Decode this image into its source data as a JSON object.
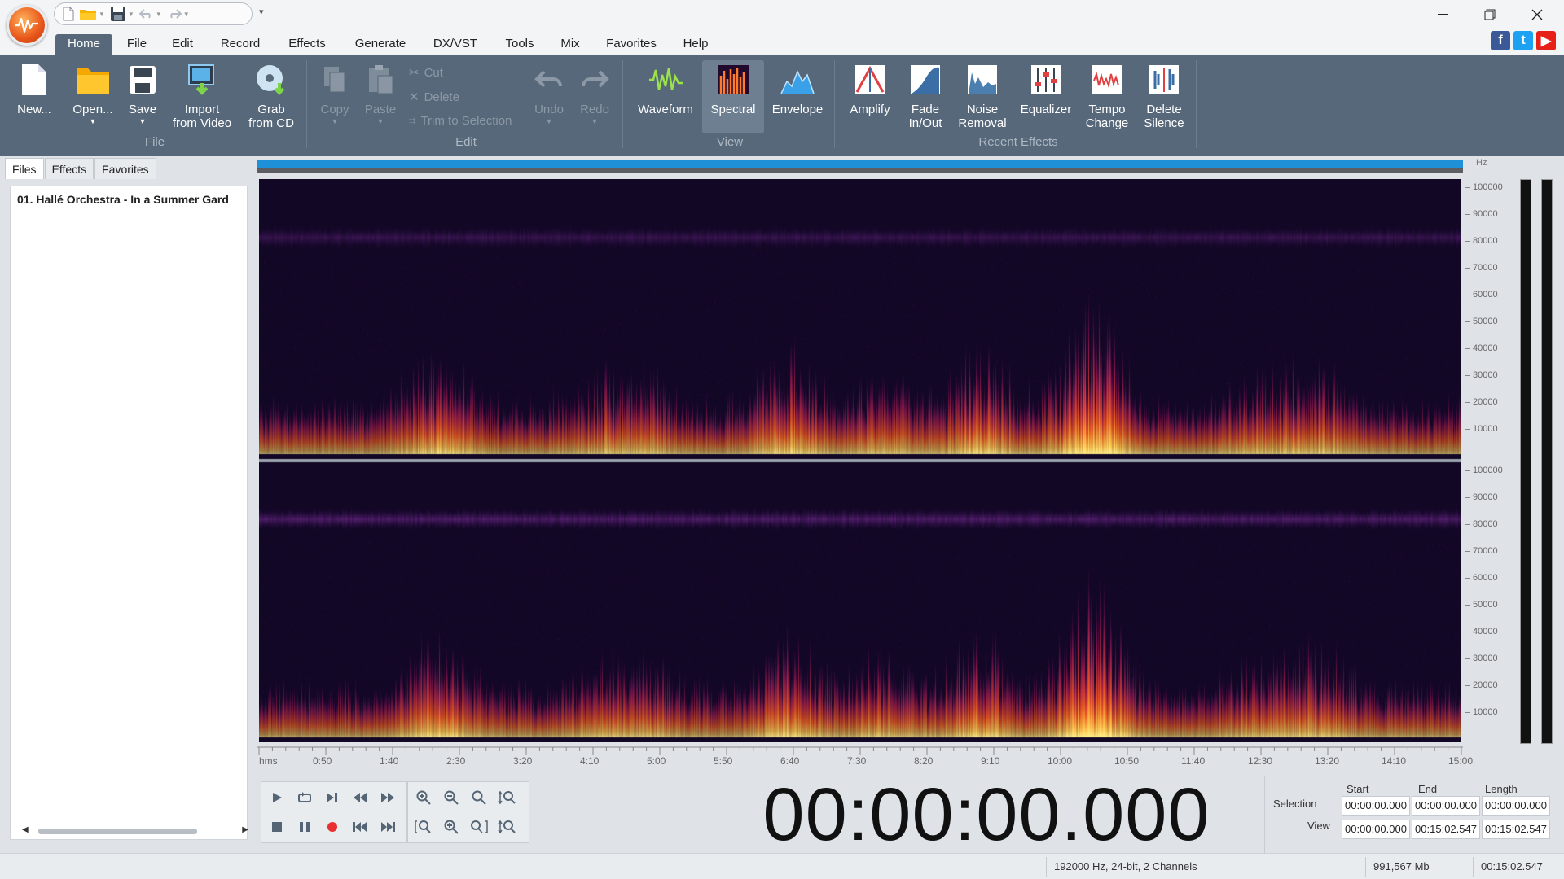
{
  "titlebar": {
    "qat_items": [
      "new-doc-icon",
      "folder-icon",
      "save-icon",
      "undo-icon",
      "redo-icon"
    ]
  },
  "menu": {
    "tabs": [
      "Home",
      "File",
      "Edit",
      "Record",
      "Effects",
      "Generate",
      "DX/VST",
      "Tools",
      "Mix",
      "Favorites",
      "Help"
    ],
    "active": "Home"
  },
  "ribbon": {
    "file": {
      "new": "New...",
      "open": "Open...",
      "save": "Save",
      "import_video_1": "Import",
      "import_video_2": "from Video",
      "grab_cd_1": "Grab",
      "grab_cd_2": "from CD",
      "group_label": "File"
    },
    "edit": {
      "copy": "Copy",
      "paste": "Paste",
      "cut": "Cut",
      "delete": "Delete",
      "trim": "Trim to Selection",
      "undo": "Undo",
      "redo": "Redo",
      "group_label": "Edit"
    },
    "view": {
      "waveform": "Waveform",
      "spectral": "Spectral",
      "envelope": "Envelope",
      "group_label": "View",
      "active": "Spectral"
    },
    "recent": {
      "amplify": "Amplify",
      "fade_1": "Fade",
      "fade_2": "In/Out",
      "noise_1": "Noise",
      "noise_2": "Removal",
      "equalizer": "Equalizer",
      "tempo_1": "Tempo",
      "tempo_2": "Change",
      "silence_1": "Delete",
      "silence_2": "Silence",
      "group_label": "Recent Effects"
    }
  },
  "sidebar": {
    "tabs": [
      "Files",
      "Effects",
      "Favorites"
    ],
    "active_tab": "Files",
    "files": [
      "01. Hallé Orchestra - In a Summer Gard"
    ]
  },
  "spectrogram": {
    "hz_unit": "Hz",
    "freq_ticks": [
      "100000",
      "90000",
      "80000",
      "70000",
      "60000",
      "50000",
      "40000",
      "30000",
      "20000",
      "10000"
    ],
    "time_unit": "hms",
    "time_ticks": [
      "0:50",
      "1:40",
      "2:30",
      "3:20",
      "4:10",
      "5:00",
      "5:50",
      "6:40",
      "7:30",
      "8:20",
      "9:10",
      "10:00",
      "10:50",
      "11:40",
      "12:30",
      "13:20",
      "14:10",
      "15:00"
    ],
    "channels": 2,
    "colors": {
      "background": "#130726",
      "low": "#e8501c",
      "mid": "#ff9a2a",
      "high": "#ffe36a",
      "band": "#7a2a9a"
    }
  },
  "transport": {
    "clock": "00:00:00.000",
    "headers": {
      "start": "Start",
      "end": "End",
      "length": "Length"
    },
    "selection": {
      "label": "Selection",
      "start": "00:00:00.000",
      "end": "00:00:00.000",
      "length": "00:00:00.000"
    },
    "view": {
      "label": "View",
      "start": "00:00:00.000",
      "end": "00:15:02.547",
      "length": "00:15:02.547"
    }
  },
  "status": {
    "format": "192000 Hz, 24-bit, 2 Channels",
    "size": "991,567 Mb",
    "duration": "00:15:02.547"
  }
}
